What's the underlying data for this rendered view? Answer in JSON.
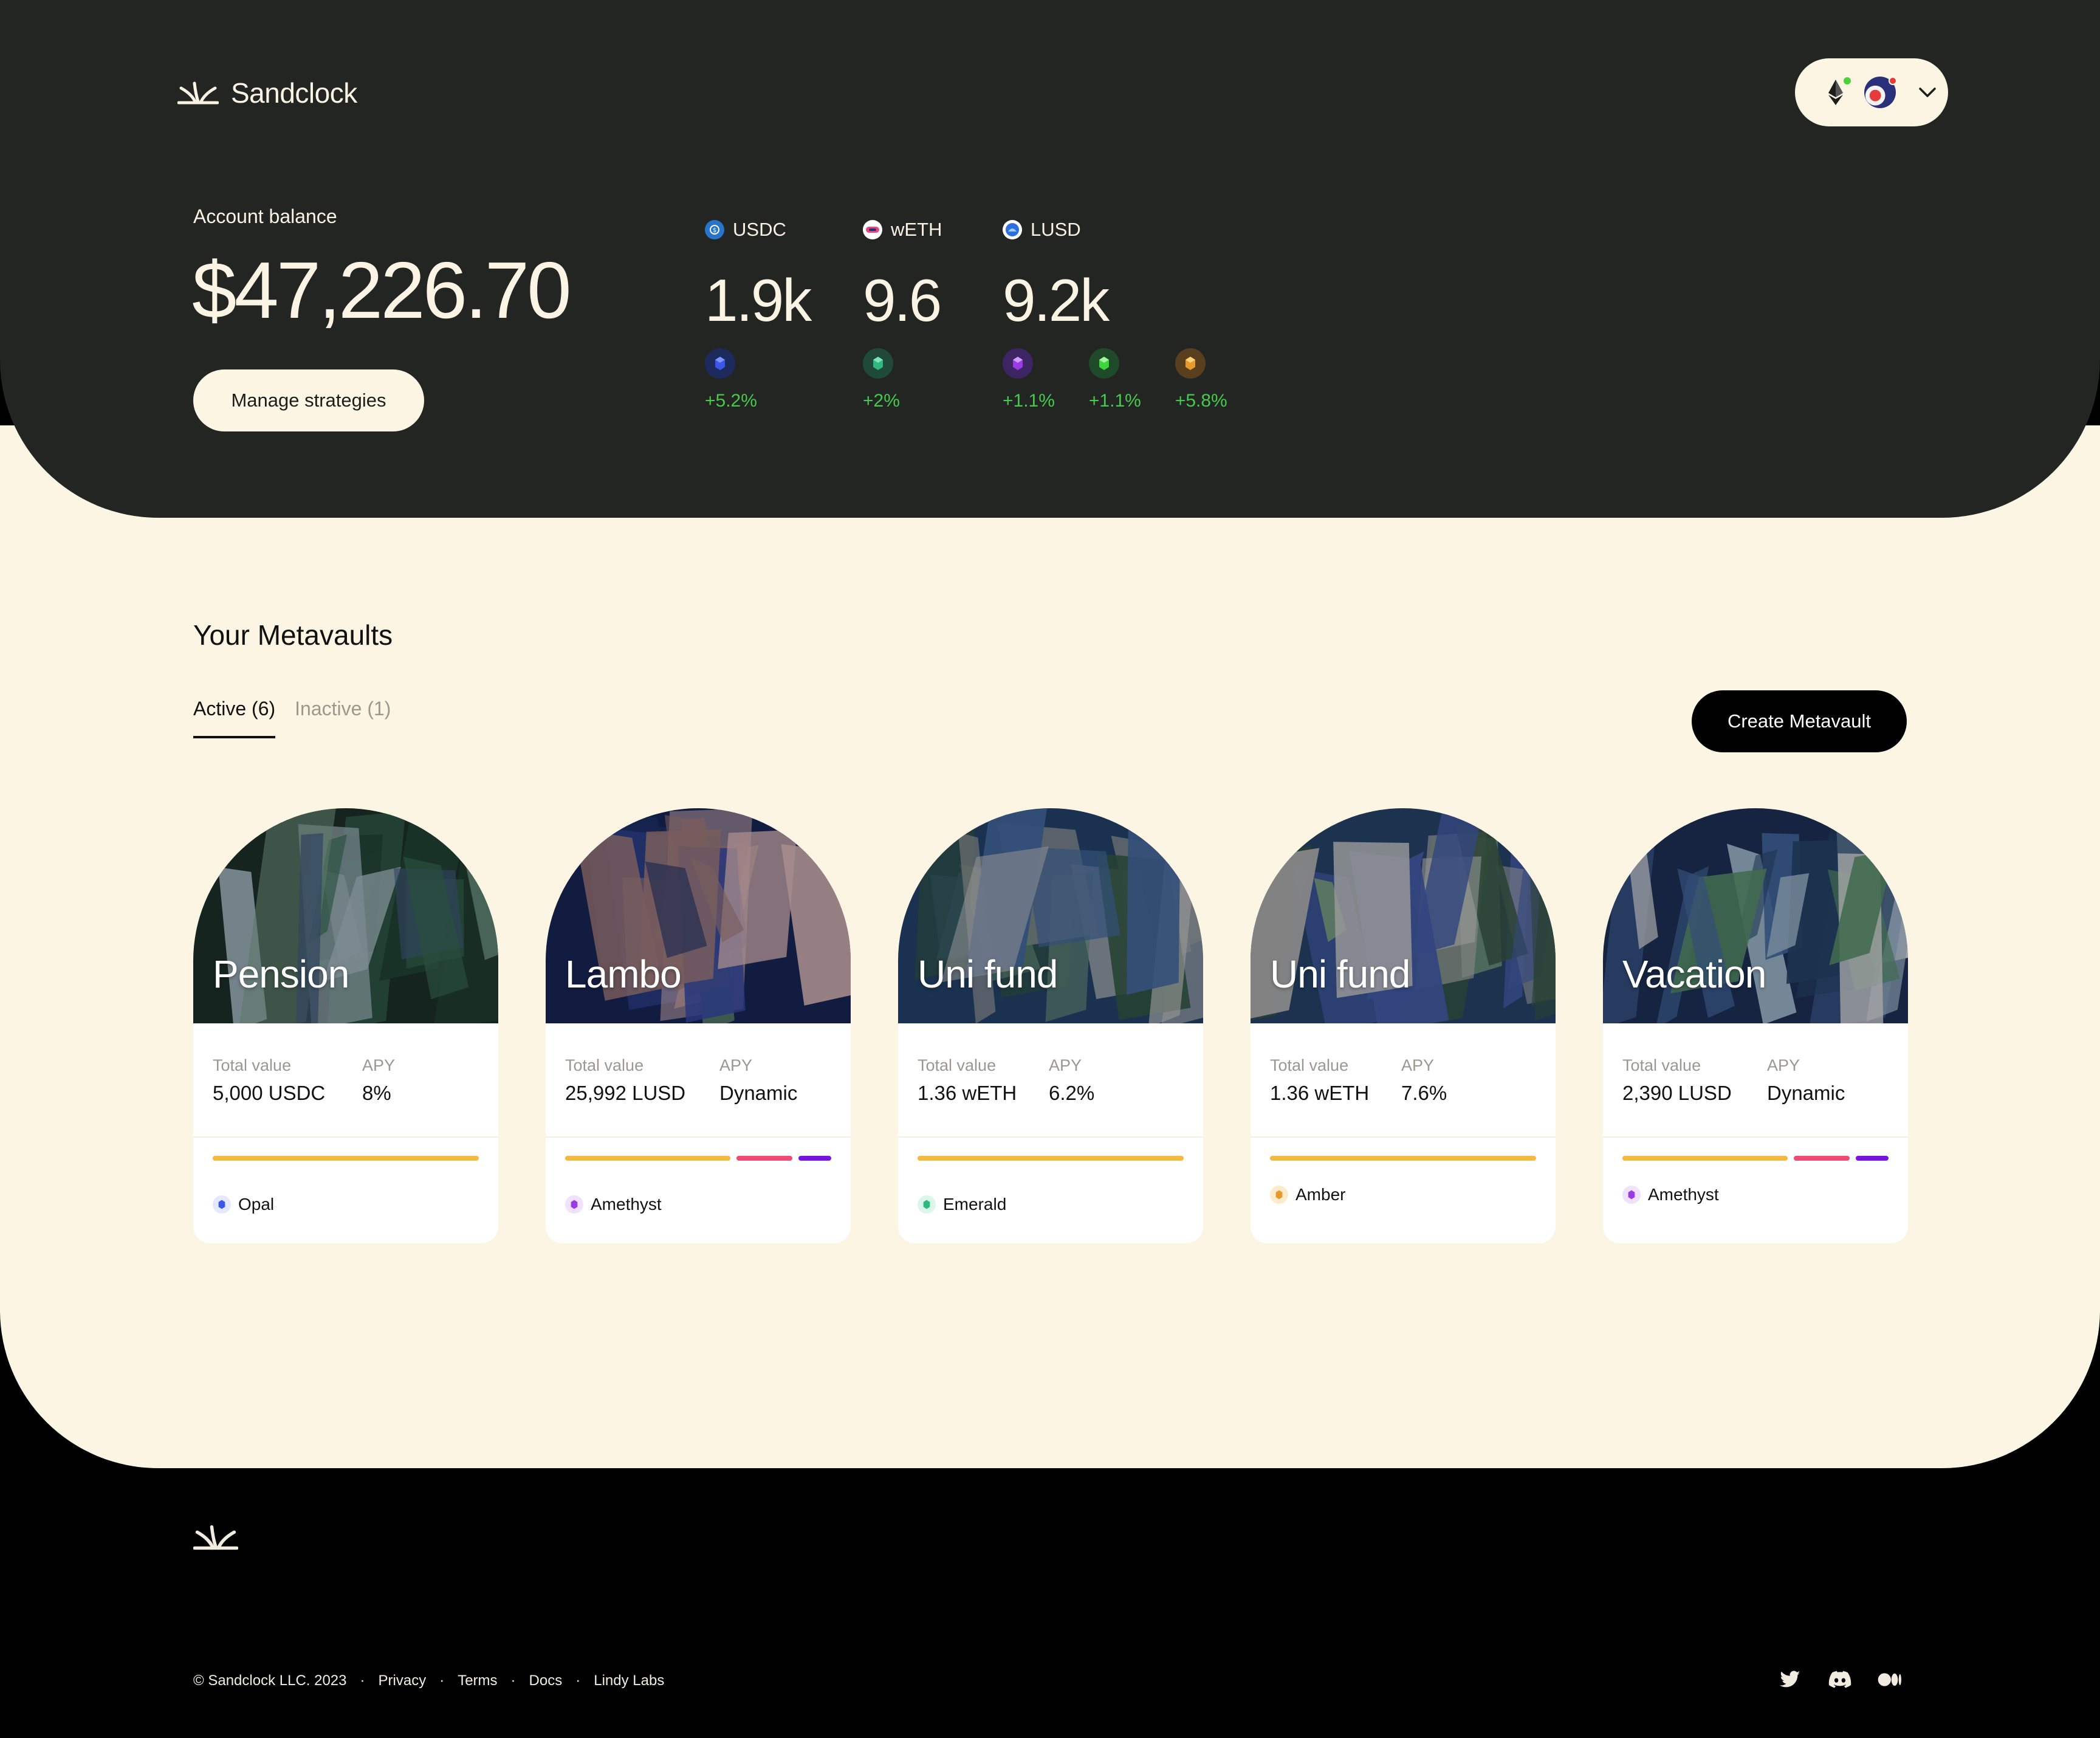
{
  "brand": {
    "name": "Sandclock"
  },
  "account": {
    "label": "Account balance",
    "value": "$47,226.70",
    "manage_label": "Manage strategies"
  },
  "tokens": [
    {
      "symbol": "USDC",
      "amount": "1.9k",
      "color": "#2775ca",
      "gems": [
        {
          "icon": "opal-gem-icon",
          "color": "#3a57e8",
          "change": "+5.2%"
        }
      ]
    },
    {
      "symbol": "wETH",
      "amount": "9.6",
      "color": "#e8467c",
      "gems": [
        {
          "icon": "emerald-gem-icon",
          "color": "#2fb87f",
          "change": "+2%"
        }
      ]
    },
    {
      "symbol": "LUSD",
      "amount": "9.2k",
      "color": "#2d6ee0",
      "gems": [
        {
          "icon": "amethyst-gem-icon",
          "color": "#9a3ce6",
          "change": "+1.1%"
        },
        {
          "icon": "emerald-gem-icon",
          "color": "#3dd53a",
          "change": "+1.1%"
        },
        {
          "icon": "amber-gem-icon",
          "color": "#e59a2a",
          "change": "+5.8%"
        }
      ]
    }
  ],
  "metavaults": {
    "title": "Your Metavaults",
    "tabs": {
      "active": "Active (6)",
      "inactive": "Inactive (1)"
    },
    "create_label": "Create Metavault",
    "stat_labels": {
      "total": "Total value",
      "apy": "APY"
    },
    "cards": [
      {
        "name": "Pension",
        "total": "5,000 USDC",
        "apy": "8%",
        "gem": "Opal",
        "gem_color": "#3a57e8",
        "alloc": [
          {
            "color": "#f5b942",
            "share": 1.0
          }
        ]
      },
      {
        "name": "Lambo",
        "total": "25,992 LUSD",
        "apy": "Dynamic",
        "gem": "Amethyst",
        "gem_color": "#9a3ce6",
        "alloc": [
          {
            "color": "#f5b942",
            "share": 0.65
          },
          {
            "color": "#ef4b74",
            "share": 0.22
          },
          {
            "color": "#7a12e0",
            "share": 0.13
          }
        ]
      },
      {
        "name": "Uni fund",
        "total": "1.36 wETH",
        "apy": "6.2%",
        "gem": "Emerald",
        "gem_color": "#2fb87f",
        "alloc": [
          {
            "color": "#f5b942",
            "share": 1.0
          }
        ]
      },
      {
        "name": "Uni fund",
        "total": "1.36 wETH",
        "apy": "7.6%",
        "gem": "Amber",
        "gem_color": "#e59a2a",
        "alloc": [
          {
            "color": "#f5b942",
            "share": 1.0
          }
        ]
      },
      {
        "name": "Vacation",
        "total": "2,390 LUSD",
        "apy": "Dynamic",
        "gem": "Amethyst",
        "gem_color": "#9a3ce6",
        "alloc": [
          {
            "color": "#f5b942",
            "share": 0.65
          },
          {
            "color": "#ef4b74",
            "share": 0.22
          },
          {
            "color": "#7a12e0",
            "share": 0.13
          }
        ]
      }
    ]
  },
  "footer": {
    "copyright": "© Sandclock LLC. 2023",
    "links": [
      "Privacy",
      "Terms",
      "Docs",
      "Lindy Labs"
    ],
    "social": [
      "twitter-icon",
      "discord-icon",
      "medium-icon"
    ]
  }
}
